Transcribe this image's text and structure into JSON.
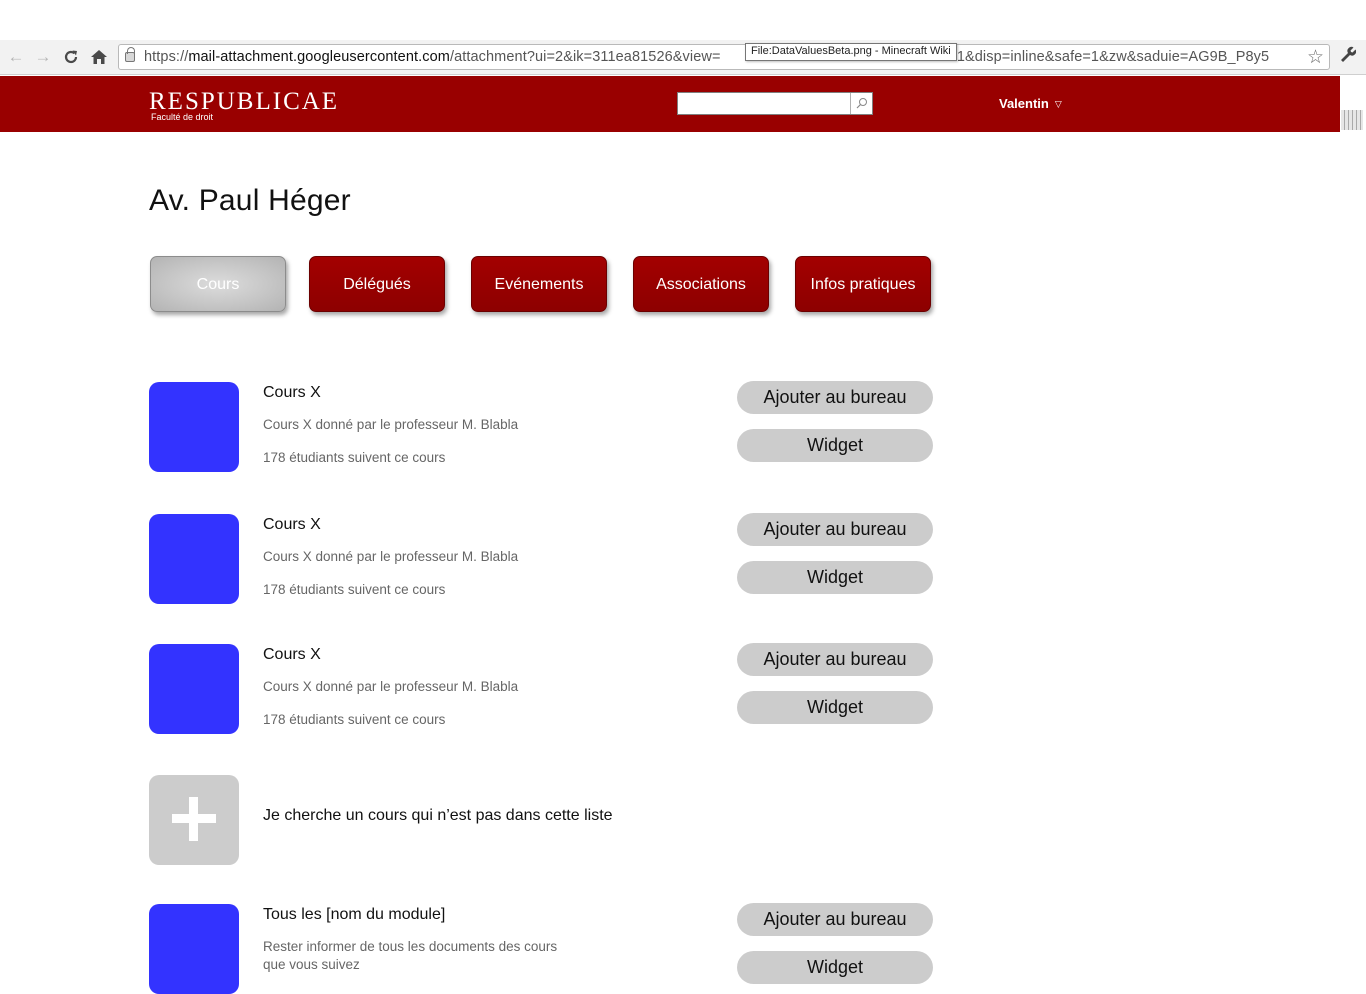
{
  "browser": {
    "url_scheme": "https://",
    "url_host": "mail-attachment.googleusercontent.com",
    "url_rest": "/attachment?ui=2&ik=311ea81526&view=",
    "url_tail": "0.1&disp=inline&safe=1&zw&saduie=AG9B_P8y5",
    "tooltip": "File:DataValuesBeta.png - Minecraft Wiki",
    "icons": [
      "back-icon",
      "forward-icon",
      "reload-icon",
      "home-icon",
      "lock-icon",
      "star-icon",
      "wrench-icon"
    ]
  },
  "header": {
    "logo": "RESPUBLICAE",
    "logo_sub": "Faculté de droit",
    "search_value": "",
    "user": "Valentin",
    "brand_color": "#990000"
  },
  "page": {
    "title": "Av. Paul Héger"
  },
  "tabs": [
    {
      "label": "Cours",
      "active": true
    },
    {
      "label": "Délégués",
      "active": false
    },
    {
      "label": "Evénements",
      "active": false
    },
    {
      "label": "Associations",
      "active": false
    },
    {
      "label": "Infos pratiques",
      "active": false
    }
  ],
  "courses": [
    {
      "title": "Cours X",
      "description": "Cours X donné par le professeur M. Blabla",
      "count": "178 étudiants suivent ce cours",
      "add_label": "Ajouter au bureau",
      "widget_label": "Widget"
    },
    {
      "title": "Cours X",
      "description": "Cours X donné par le professeur M. Blabla",
      "count": "178 étudiants suivent ce cours",
      "add_label": "Ajouter au bureau",
      "widget_label": "Widget"
    },
    {
      "title": "Cours X",
      "description": "Cours X donné par le professeur M. Blabla",
      "count": "178 étudiants suivent ce cours",
      "add_label": "Ajouter au bureau",
      "widget_label": "Widget"
    }
  ],
  "add_course": {
    "label": "Je cherche un cours qui n’est pas dans cette liste"
  },
  "module": {
    "title": "Tous les [nom du module]",
    "description_line1": "Rester informer de tous les documents des cours",
    "description_line2": "que vous suivez",
    "add_label": "Ajouter au bureau",
    "widget_label": "Widget"
  },
  "colors": {
    "thumb": "#3333ff",
    "pill": "#cccccc",
    "active_tab": "#c6c6c6"
  }
}
